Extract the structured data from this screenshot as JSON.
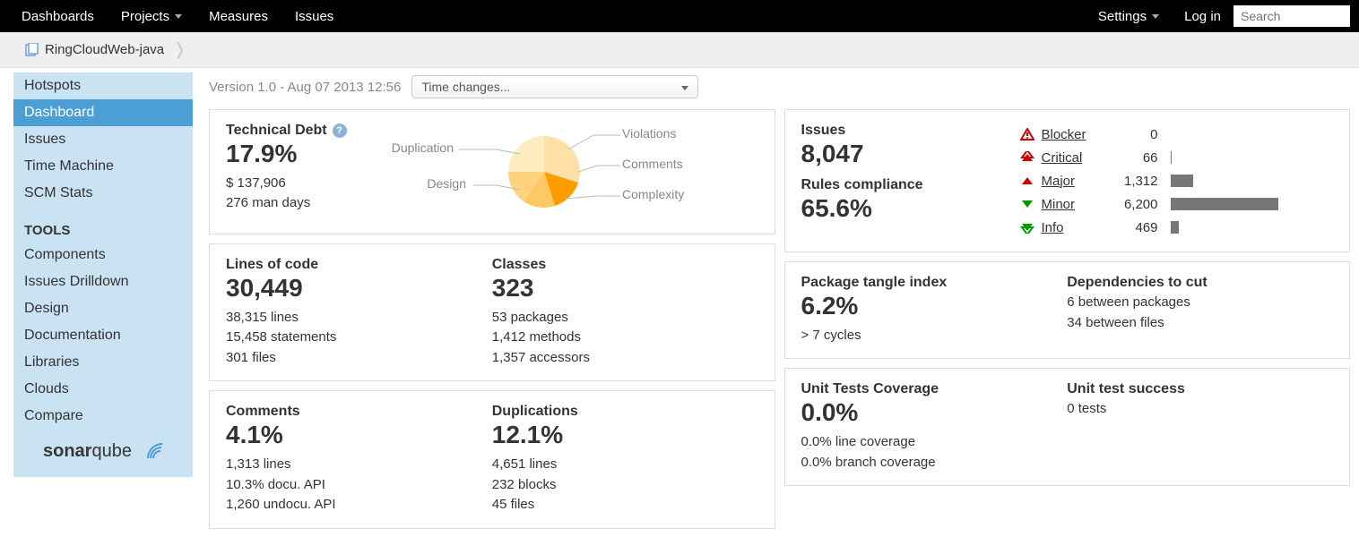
{
  "topnav": {
    "dashboards": "Dashboards",
    "projects": "Projects",
    "measures": "Measures",
    "issues": "Issues",
    "settings": "Settings",
    "login": "Log in",
    "search_placeholder": "Search"
  },
  "breadcrumb": {
    "project": "RingCloudWeb-java"
  },
  "sidebar": {
    "items": [
      "Hotspots",
      "Dashboard",
      "Issues",
      "Time Machine",
      "SCM Stats"
    ],
    "active_index": 1,
    "tools_heading": "TOOLS",
    "tools": [
      "Components",
      "Issues Drilldown",
      "Design",
      "Documentation",
      "Libraries",
      "Clouds",
      "Compare"
    ],
    "logo_text_a": "sonar",
    "logo_text_b": "qube"
  },
  "version_line": "Version 1.0 - Aug 07 2013 12:56",
  "time_dropdown": "Time changes...",
  "widget_tech_debt": {
    "title": "Technical Debt",
    "percent": "17.9%",
    "cost": "$ 137,906",
    "days": "276 man days",
    "pie_labels": {
      "violations": "Violations",
      "comments": "Comments",
      "complexity": "Complexity",
      "design": "Design",
      "duplication": "Duplication"
    }
  },
  "widget_size": {
    "loc_title": "Lines of code",
    "loc": "30,449",
    "loc_lines": [
      "38,315 lines",
      "15,458 statements",
      "301 files"
    ],
    "classes_title": "Classes",
    "classes": "323",
    "classes_lines": [
      "53 packages",
      "1,412 methods",
      "1,357 accessors"
    ]
  },
  "widget_cd": {
    "comments_title": "Comments",
    "comments": "4.1%",
    "comments_lines": [
      "1,313 lines",
      "10.3% docu. API",
      "1,260 undocu. API"
    ],
    "dup_title": "Duplications",
    "dup": "12.1%",
    "dup_lines": [
      "4,651 lines",
      "232 blocks",
      "45 files"
    ]
  },
  "widget_issues": {
    "issues_title": "Issues",
    "issues": "8,047",
    "rules_title": "Rules compliance",
    "rules": "65.6%",
    "severities": [
      {
        "name": "Blocker",
        "count": "0",
        "bar_pct": 0,
        "icon": "blocker"
      },
      {
        "name": "Critical",
        "count": "66",
        "bar_pct": 1,
        "icon": "critical"
      },
      {
        "name": "Major",
        "count": "1,312",
        "bar_pct": 21,
        "icon": "major"
      },
      {
        "name": "Minor",
        "count": "6,200",
        "bar_pct": 100,
        "icon": "minor"
      },
      {
        "name": "Info",
        "count": "469",
        "bar_pct": 8,
        "icon": "info"
      }
    ]
  },
  "widget_tangle": {
    "pti_title": "Package tangle index",
    "pti": "6.2%",
    "pti_sub": "> 7 cycles",
    "deps_title": "Dependencies to cut",
    "deps_lines": [
      "6 between packages",
      "34 between files"
    ]
  },
  "widget_tests": {
    "cov_title": "Unit Tests Coverage",
    "cov": "0.0%",
    "cov_lines": [
      "0.0% line coverage",
      "0.0% branch coverage"
    ],
    "succ_title": "Unit test success",
    "succ_lines": [
      "0 tests"
    ]
  },
  "chart_data": {
    "type": "pie",
    "title": "Technical Debt breakdown",
    "series": [
      {
        "name": "Violations",
        "value": 40
      },
      {
        "name": "Comments",
        "value": 25
      },
      {
        "name": "Complexity",
        "value": 15
      },
      {
        "name": "Design",
        "value": 10
      },
      {
        "name": "Duplication",
        "value": 10
      }
    ]
  }
}
